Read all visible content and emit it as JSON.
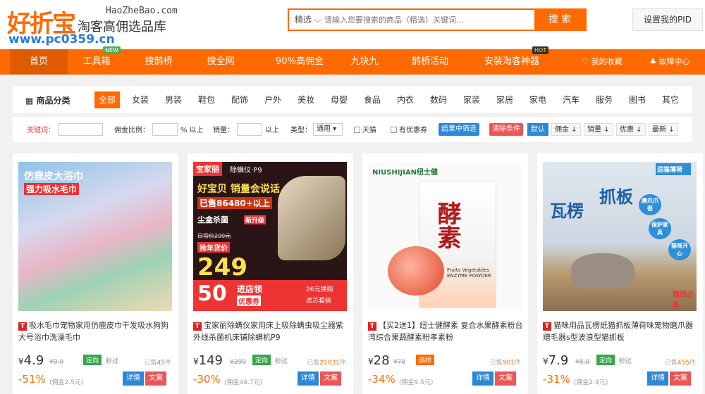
{
  "header": {
    "logo_text": "好折宝",
    "logo_url": "HaoZheBao.com",
    "tagline": "淘客高佣选品库",
    "watermark": "www.pc0359.cn",
    "search_select": "精选",
    "search_placeholder": "请输入您要搜索的商品（精选）关键词...",
    "search_button": "搜 索",
    "pid_button": "设置我的PID"
  },
  "nav": {
    "items": [
      "首页",
      "工具箱",
      "搜鹊桥",
      "搜全网",
      "90%高佣金",
      "九块九",
      "鹊桥活动",
      "安装淘客神器",
      "♡ 我的收藏",
      "♣ 故障中心"
    ],
    "badge_new": "NEW",
    "badge_hot": "HOT"
  },
  "categories": {
    "title": "商品分类",
    "items": [
      "全部",
      "女装",
      "男装",
      "鞋包",
      "配饰",
      "户外",
      "美妆",
      "母婴",
      "食品",
      "内衣",
      "数码",
      "家装",
      "家居",
      "家电",
      "汽车",
      "服务",
      "图书",
      "其它"
    ]
  },
  "filters": {
    "keyword_label": "关键词：",
    "ratio_label": "佣金比例：",
    "ratio_unit": "% 以上",
    "sales_label": "销量：",
    "sales_unit": "以上",
    "type_label": "类型：",
    "type_value": "通用 ▾",
    "tmall": "天猫",
    "coupon": "有优惠券",
    "filter_btn": "结果中筛选",
    "clear_btn": "清除条件",
    "sorts": [
      "默认",
      "佣金 ↓",
      "销量 ↓",
      "优惠 ↓",
      "最新 ↓"
    ]
  },
  "products": [
    {
      "title": "吸水毛巾宠物家用仿鹿皮巾干发吸水狗狗大号浴巾洗澡毛巾",
      "price": "4.9",
      "orig": "¥9.9",
      "tag": "定向",
      "tag_color": "#3aa54b",
      "tag2": "秒过",
      "sold": "45",
      "discount": "-51%",
      "commission": "(佣金2.5元)",
      "img_text": [
        "仿鹿皮大浴巾",
        "强力吸水毛巾"
      ]
    },
    {
      "title": "宝家丽除螨仪家用床上吸除螨虫吸尘器紫外线杀菌机床铺除螨机P9",
      "price": "149",
      "orig": "¥299",
      "tag": "定向",
      "tag_color": "#3aa54b",
      "tag2": "秒过",
      "sold": "21031",
      "discount": "-30%",
      "commission": "(佣金44.7元)",
      "img_text": [
        "宝家丽",
        "除螨仪·P9",
        "好宝贝 销量会说话",
        "已售86480+以上",
        "尘盒杀菌",
        "249",
        "50",
        "进店领",
        "优惠券",
        "26元换购",
        "滤芯套装",
        "抢年货价",
        "日常价299元",
        "新升级"
      ]
    },
    {
      "title": "【买2送1】纽士健酵素 复合水果酵素粉台湾综合果蔬酵素粉孝素粉",
      "price": "28",
      "orig": "¥78",
      "tag": "鹊桥",
      "tag_color": "#ff6a00",
      "tag2": "",
      "sold": "901",
      "discount": "-34%",
      "commission": "(佣金9.5元)",
      "img_text": [
        "NIUSHIJIAN纽士健",
        "酵素",
        "Fruits Vegetables ENZYME POWDER"
      ]
    },
    {
      "title": "猫咪用品瓦楞纸猫抓板薄荷味宠物磨爪器赠毛器s型波浪型猫抓板",
      "price": "7.9",
      "orig": "¥8.9",
      "tag": "定向",
      "tag_color": "#3aa54b",
      "tag2": "秒过",
      "sold": "455",
      "discount": "-31%",
      "commission": "(佣金2.4元)",
      "img_text": [
        "瓦楞",
        "抓板",
        "送猫薄荷",
        "磨爪爪很",
        "保护家具",
        "猫咪开心",
        "猫奴必备"
      ]
    }
  ],
  "labels": {
    "detail": "详情",
    "copy": "文案",
    "sold_prefix": "已售",
    "sold_suffix": "件",
    "yen": "¥",
    "tmall_mark": "T"
  },
  "colors": {
    "accent": "#ff6a00",
    "blue": "#2d87d8",
    "red": "#e55"
  }
}
